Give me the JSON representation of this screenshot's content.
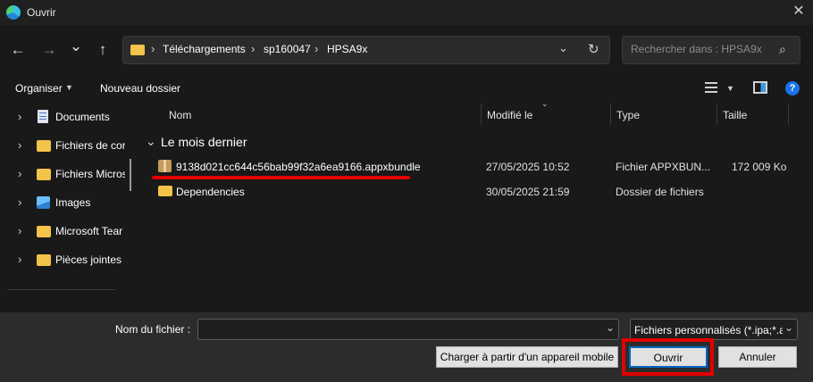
{
  "window": {
    "title": "Ouvrir",
    "close_glyph": "✕"
  },
  "nav": {
    "back_glyph": "←",
    "forward_glyph": "→",
    "recent_glyph": "⌄",
    "up_glyph": "↑",
    "breadcrumb": [
      "Téléchargements",
      "sp160047",
      "HPSA9x"
    ],
    "sep_glyph": "›",
    "search_placeholder": "Rechercher dans : HPSA9x"
  },
  "toolbar": {
    "organize": "Organiser",
    "new_folder": "Nouveau dossier"
  },
  "sidebar": {
    "items": [
      {
        "label": "Documents",
        "icon": "document-icon"
      },
      {
        "label": "Fichiers de cor",
        "icon": "folder-icon"
      },
      {
        "label": "Fichiers Micros",
        "icon": "folder-icon"
      },
      {
        "label": "Images",
        "icon": "image-icon"
      },
      {
        "label": "Microsoft Tear",
        "icon": "folder-icon"
      },
      {
        "label": "Pièces jointes",
        "icon": "folder-icon"
      }
    ]
  },
  "columns": {
    "name": "Nom",
    "modified": "Modifié le",
    "type": "Type",
    "size": "Taille"
  },
  "group": {
    "label": "Le mois dernier"
  },
  "files": [
    {
      "name": "9138d021cc644c56bab99f32a6ea9166.appxbundle",
      "modified": "27/05/2025 10:52",
      "type": "Fichier APPXBUN...",
      "size": "172 009 Ko",
      "icon": "package-icon"
    },
    {
      "name": "Dependencies",
      "modified": "30/05/2025 21:59",
      "type": "Dossier de fichiers",
      "size": "",
      "icon": "folder-icon"
    }
  ],
  "bottom": {
    "filename_label": "Nom du fichier :",
    "filename_value": "",
    "filter_value": "Fichiers personnalisés (*.ipa;*.ap",
    "mobile_button": "Charger à partir d'un appareil mobile",
    "open_button": "Ouvrir",
    "cancel_button": "Annuler"
  },
  "colors": {
    "highlight": "#e10000",
    "folder": "#f3c34a",
    "accent": "#0078d4"
  }
}
